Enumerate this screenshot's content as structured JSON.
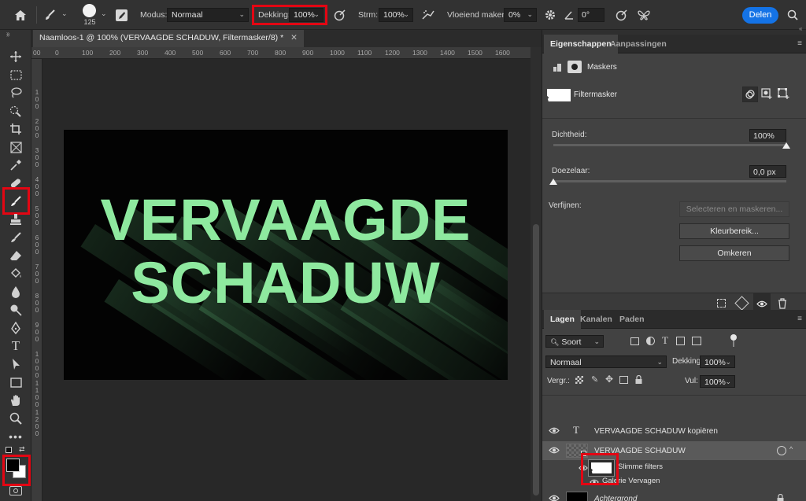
{
  "options_bar": {
    "brush_size": "125",
    "modus_label": "Modus:",
    "modus_value": "Normaal",
    "dekking_label": "Dekking:",
    "dekking_value": "100%",
    "strm_label": "Strm:",
    "strm_value": "100%",
    "vloeiend_label": "Vloeiend maken:",
    "vloeiend_value": "0%",
    "angle_value": "0°",
    "share_label": "Delen"
  },
  "document": {
    "tab_title": "Naamloos-1 @ 100% (VERVAAGDE SCHADUW, Filtermasker/8) *",
    "ruler_h": [
      "00",
      "0",
      "100",
      "200",
      "300",
      "400",
      "500",
      "600",
      "700",
      "800",
      "900",
      "1000",
      "1100",
      "1200",
      "1300",
      "1400",
      "1500",
      "1600"
    ],
    "ruler_v": [
      "1 0 0",
      "2 0 0",
      "3 0 0",
      "4 0 0",
      "5 0 0",
      "6 0 0",
      "7 0 0",
      "8 0 0",
      "9 0 0",
      "1 0 0 0",
      "1 1 0 0",
      "1 2 0 0"
    ],
    "art_line1": "VERVAAGDE",
    "art_line2": "SCHADUW"
  },
  "properties_panel": {
    "tabs": [
      "Eigenschappen",
      "Aanpassingen"
    ],
    "section_title": "Maskers",
    "mask_label": "Filtermasker",
    "density_label": "Dichtheid:",
    "density_value": "100%",
    "density_level": 1.0,
    "feather_label": "Doezelaar:",
    "feather_value": "0,0 px",
    "feather_level": 0.0,
    "refine_label": "Verfijnen:",
    "btn_select_mask": "Selecteren en maskeren...",
    "btn_color_range": "Kleurbereik...",
    "btn_invert": "Omkeren"
  },
  "layers_panel": {
    "tabs": [
      "Lagen",
      "Kanalen",
      "Paden"
    ],
    "filter_kind": "Soort",
    "blend_mode": "Normaal",
    "opacity_label": "Dekking:",
    "opacity_value": "100%",
    "lock_label": "Vergr.:",
    "fill_label": "Vul:",
    "fill_value": "100%",
    "layers": [
      {
        "name": "VERVAAGDE SCHADUW kopiëren",
        "type": "text"
      },
      {
        "name": "VERVAAGDE SCHADUW",
        "type": "smart"
      },
      {
        "name": "Slimme filters",
        "type": "filters"
      },
      {
        "name": "Galerie Vervagen",
        "type": "filter"
      },
      {
        "name": "Achtergrond",
        "type": "background"
      }
    ]
  },
  "colors": {
    "highlight_red": "#e30613",
    "art_green": "#8ee99f",
    "share_blue": "#1473e6"
  }
}
